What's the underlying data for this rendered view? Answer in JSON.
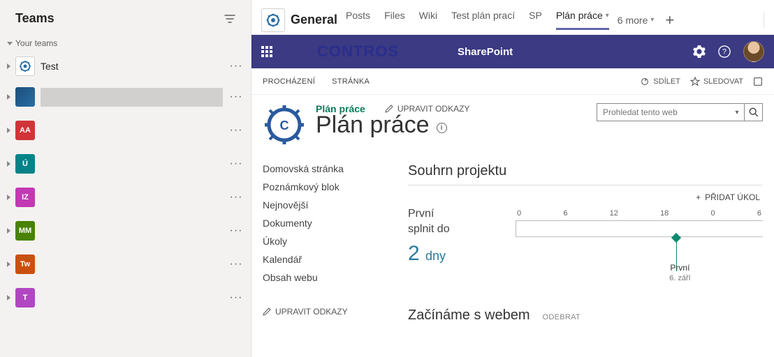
{
  "sidebar": {
    "title": "Teams",
    "section_label": "Your teams",
    "teams": [
      {
        "label": "Test",
        "avatar_type": "gear"
      }
    ],
    "avatars_below": [
      {
        "initials": "",
        "cls": "av-octo"
      },
      {
        "initials": "AA",
        "cls": "av-aa"
      },
      {
        "initials": "Ú",
        "cls": "av-u"
      },
      {
        "initials": "IZ",
        "cls": "av-iz"
      },
      {
        "initials": "MM",
        "cls": "av-mm"
      },
      {
        "initials": "Tw",
        "cls": "av-tw"
      },
      {
        "initials": "T",
        "cls": "av-t"
      }
    ]
  },
  "channel": {
    "name": "General",
    "tabs": [
      "Posts",
      "Files",
      "Wiki",
      "Test plán prací",
      "SP",
      "Plán práce"
    ],
    "active_tab": "Plán práce",
    "more_label": "6 more"
  },
  "sp_bar": {
    "brand": "CONTROS",
    "product": "SharePoint"
  },
  "sp_actions": {
    "browse": "PROCHÁZENÍ",
    "page": "STRÁNKA",
    "share": "SDÍLET",
    "follow": "SLEDOVAT"
  },
  "sp_head": {
    "breadcrumb": "Plán práce",
    "edit_links": "UPRAVIT ODKAZY",
    "title": "Plán práce",
    "search_placeholder": "Prohledat tento web"
  },
  "sp_nav": {
    "items": [
      "Domovská stránka",
      "Poznámkový blok",
      "Nejnovější",
      "Dokumenty",
      "Úkoly",
      "Kalendář",
      "Obsah webu"
    ],
    "edit": "UPRAVIT ODKAZY"
  },
  "project": {
    "section": "Souhrn projektu",
    "add_task": "PŘIDAT ÚKOL",
    "deadline_label1": "První",
    "deadline_label2": "splnit do",
    "deadline_value": "2",
    "deadline_unit": "dny",
    "ticks": [
      "0",
      "6",
      "12",
      "18",
      "0",
      "6"
    ],
    "marker_label": "První",
    "marker_date": "6. září"
  },
  "getting_started": {
    "title": "Začínáme s webem",
    "remove": "ODEBRAT"
  }
}
